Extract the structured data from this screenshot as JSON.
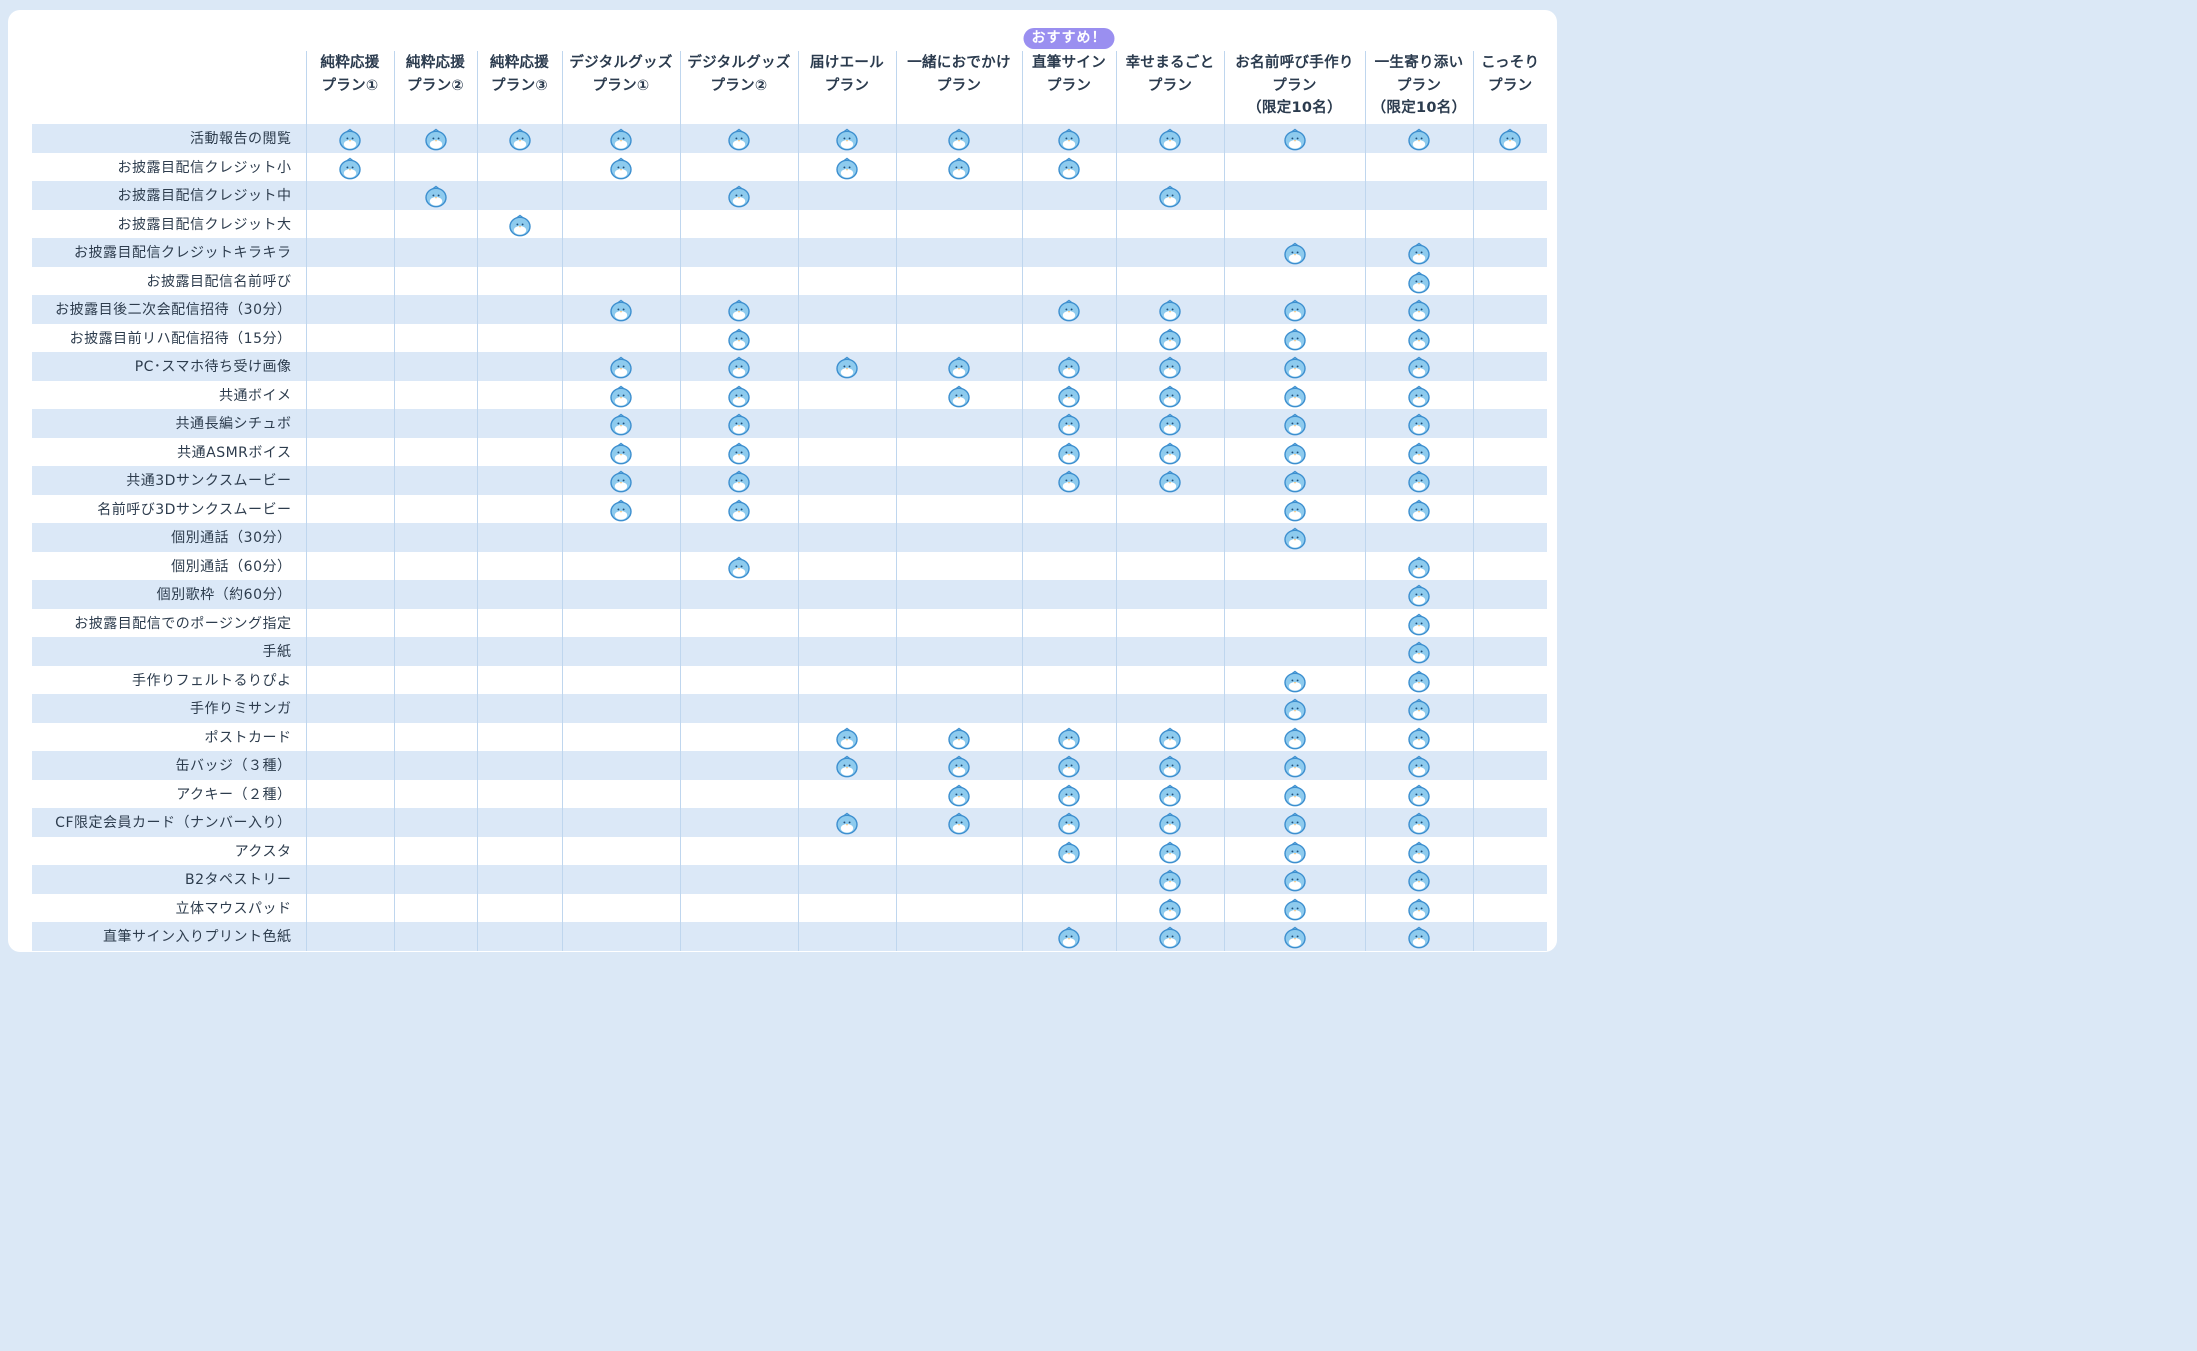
{
  "recommend_badge": "おすすめ！",
  "plans": [
    {
      "label": "純粋応援\nプラン①"
    },
    {
      "label": "純粋応援\nプラン②"
    },
    {
      "label": "純粋応援\nプラン③"
    },
    {
      "label": "デジタルグッズ\nプラン①"
    },
    {
      "label": "デジタルグッズ\nプラン②"
    },
    {
      "label": "届けエール\nプラン"
    },
    {
      "label": "一緒におでかけ\nプラン"
    },
    {
      "label": "直筆サイン\nプラン",
      "recommended": true
    },
    {
      "label": "幸せまるごと\nプラン"
    },
    {
      "label": "お名前呼び手作り\nプラン\n（限定10名）"
    },
    {
      "label": "一生寄り添い\nプラン\n（限定10名）"
    },
    {
      "label": "こっそり\nプラン"
    }
  ],
  "features": [
    {
      "label": "活動報告の閲覧",
      "included": [
        1,
        1,
        1,
        1,
        1,
        1,
        1,
        1,
        1,
        1,
        1,
        1
      ]
    },
    {
      "label": "お披露目配信クレジット小",
      "included": [
        1,
        0,
        0,
        1,
        0,
        1,
        1,
        1,
        0,
        0,
        0,
        0
      ]
    },
    {
      "label": "お披露目配信クレジット中",
      "included": [
        0,
        1,
        0,
        0,
        1,
        0,
        0,
        0,
        1,
        0,
        0,
        0
      ]
    },
    {
      "label": "お披露目配信クレジット大",
      "included": [
        0,
        0,
        1,
        0,
        0,
        0,
        0,
        0,
        0,
        0,
        0,
        0
      ]
    },
    {
      "label": "お披露目配信クレジットキラキラ",
      "included": [
        0,
        0,
        0,
        0,
        0,
        0,
        0,
        0,
        0,
        1,
        1,
        0
      ]
    },
    {
      "label": "お披露目配信名前呼び",
      "included": [
        0,
        0,
        0,
        0,
        0,
        0,
        0,
        0,
        0,
        0,
        1,
        0
      ]
    },
    {
      "label": "お披露目後二次会配信招待（30分）",
      "included": [
        0,
        0,
        0,
        1,
        1,
        0,
        0,
        1,
        1,
        1,
        1,
        0
      ]
    },
    {
      "label": "お披露目前リハ配信招待（15分）",
      "included": [
        0,
        0,
        0,
        0,
        1,
        0,
        0,
        0,
        1,
        1,
        1,
        0
      ]
    },
    {
      "label": "PC･スマホ待ち受け画像",
      "included": [
        0,
        0,
        0,
        1,
        1,
        1,
        1,
        1,
        1,
        1,
        1,
        0
      ]
    },
    {
      "label": "共通ボイメ",
      "included": [
        0,
        0,
        0,
        1,
        1,
        0,
        1,
        1,
        1,
        1,
        1,
        0
      ]
    },
    {
      "label": "共通長編シチュボ",
      "included": [
        0,
        0,
        0,
        1,
        1,
        0,
        0,
        1,
        1,
        1,
        1,
        0
      ]
    },
    {
      "label": "共通ASMRボイス",
      "included": [
        0,
        0,
        0,
        1,
        1,
        0,
        0,
        1,
        1,
        1,
        1,
        0
      ]
    },
    {
      "label": "共通3Dサンクスムービー",
      "included": [
        0,
        0,
        0,
        1,
        1,
        0,
        0,
        1,
        1,
        1,
        1,
        0
      ]
    },
    {
      "label": "名前呼び3Dサンクスムービー",
      "included": [
        0,
        0,
        0,
        1,
        1,
        0,
        0,
        0,
        0,
        1,
        1,
        0
      ]
    },
    {
      "label": "個別通話（30分）",
      "included": [
        0,
        0,
        0,
        0,
        0,
        0,
        0,
        0,
        0,
        1,
        0,
        0
      ]
    },
    {
      "label": "個別通話（60分）",
      "included": [
        0,
        0,
        0,
        0,
        1,
        0,
        0,
        0,
        0,
        0,
        1,
        0
      ]
    },
    {
      "label": "個別歌枠（約60分）",
      "included": [
        0,
        0,
        0,
        0,
        0,
        0,
        0,
        0,
        0,
        0,
        1,
        0
      ]
    },
    {
      "label": "お披露目配信でのポージング指定",
      "included": [
        0,
        0,
        0,
        0,
        0,
        0,
        0,
        0,
        0,
        0,
        1,
        0
      ]
    },
    {
      "label": "手紙",
      "included": [
        0,
        0,
        0,
        0,
        0,
        0,
        0,
        0,
        0,
        0,
        1,
        0
      ]
    },
    {
      "label": "手作りフェルトるりぴよ",
      "included": [
        0,
        0,
        0,
        0,
        0,
        0,
        0,
        0,
        0,
        1,
        1,
        0
      ]
    },
    {
      "label": "手作りミサンガ",
      "included": [
        0,
        0,
        0,
        0,
        0,
        0,
        0,
        0,
        0,
        1,
        1,
        0
      ]
    },
    {
      "label": "ポストカード",
      "included": [
        0,
        0,
        0,
        0,
        0,
        1,
        1,
        1,
        1,
        1,
        1,
        0
      ]
    },
    {
      "label": "缶バッジ（３種）",
      "included": [
        0,
        0,
        0,
        0,
        0,
        1,
        1,
        1,
        1,
        1,
        1,
        0
      ]
    },
    {
      "label": "アクキー（２種）",
      "included": [
        0,
        0,
        0,
        0,
        0,
        0,
        1,
        1,
        1,
        1,
        1,
        0
      ]
    },
    {
      "label": "CF限定会員カード（ナンバー入り）",
      "included": [
        0,
        0,
        0,
        0,
        0,
        1,
        1,
        1,
        1,
        1,
        1,
        0
      ]
    },
    {
      "label": "アクスタ",
      "included": [
        0,
        0,
        0,
        0,
        0,
        0,
        0,
        1,
        1,
        1,
        1,
        0
      ]
    },
    {
      "label": "B2タペストリー",
      "included": [
        0,
        0,
        0,
        0,
        0,
        0,
        0,
        0,
        1,
        1,
        1,
        0
      ]
    },
    {
      "label": "立体マウスパッド",
      "included": [
        0,
        0,
        0,
        0,
        0,
        0,
        0,
        0,
        1,
        1,
        1,
        0
      ]
    },
    {
      "label": "直筆サイン入りプリント色紙",
      "included": [
        0,
        0,
        0,
        0,
        0,
        0,
        0,
        1,
        1,
        1,
        1,
        0
      ]
    }
  ],
  "icon": "bird-mascot-icon",
  "colors": {
    "page_background": "#dbe8f6",
    "row_stripe": "#dbe8f7",
    "grid_line": "#bfd6ee",
    "badge": "#9a8ff0",
    "mascot_body": "#8ecbee",
    "mascot_outline": "#3d8fcf"
  }
}
